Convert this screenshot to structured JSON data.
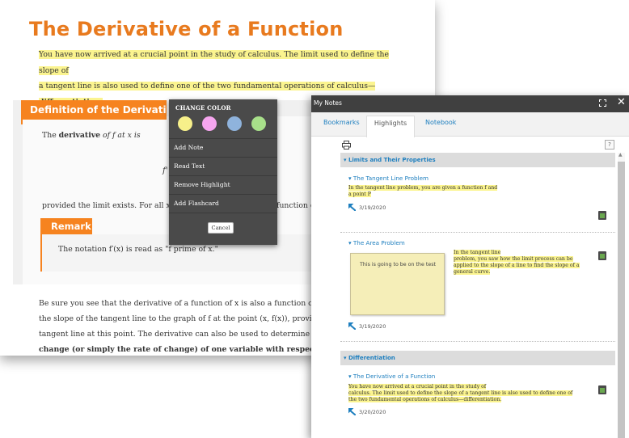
{
  "book": {
    "title": "The Derivative of a Function",
    "intro_line1": "You have now arrived at a crucial point in the study of calculus. The limit used to define the slope of",
    "intro_line2": "a tangent line is also used to define one of the two fundamental operations of calculus—",
    "intro_line3": "differentiation.",
    "definition_tab": "Definition of the Derivative",
    "definition_text_prefix": "The ",
    "definition_text_bold": "derivative",
    "definition_text_suffix": " of f at x is",
    "formula_fragment": "f'",
    "provided_text": "provided the limit exists. For all x fo",
    "provided_tail": "function o",
    "remark_tab": "Remark",
    "remark_text": "The notation f′(x) is read as \"f prime of x.\"",
    "body_line1": "Be sure you see that the derivative of a function of x is also a function of x. Th",
    "body_line2": "the slope of the tangent line to the graph of f at the point (x, f(x)), provided t",
    "body_line3": "tangent line at this point. The derivative can also be used to determine the ins",
    "body_line4": "change (or simply the rate of change) of one variable with respect to anothe"
  },
  "context_menu": {
    "title": "CHANGE COLOR",
    "colors": [
      "#f7f08a",
      "#f6a6ef",
      "#8fb3dc",
      "#a8e08a"
    ],
    "items": [
      "Add Note",
      "Read Text",
      "Remove Highlight",
      "Add Flashcard"
    ],
    "cancel": "Cancel"
  },
  "notes_panel": {
    "title": "My Notes",
    "tabs": [
      "Bookmarks",
      "Highlights",
      "Notebook"
    ],
    "active_tab": "Highlights",
    "help": "?",
    "sections": [
      {
        "heading": "▾ Limits and Their Properties",
        "notes": [
          {
            "link": "▾ The Tangent Line Problem",
            "quote_line1": "In the tangent line problem, you are given a function f and",
            "quote_line2": "a point P",
            "date": "3/19/2020"
          },
          {
            "link": "▾ The Area Problem",
            "sticky_text": "This is going to be on the test",
            "quote_line1": "In the tangent line",
            "quote_line2": "problem, you saw how the limit process can be",
            "quote_line3": "applied to the slope of a line to find the slope of a",
            "quote_line4": "general curve.",
            "date": "3/19/2020"
          }
        ]
      },
      {
        "heading": "▾ Differentiation",
        "notes": [
          {
            "link": "▾ The Derivative of a Function",
            "quote_line1": "You have now arrived at a crucial point in the study of",
            "quote_line2": "calculus. The limit used to define the slope of a tangent line is also used to define one of",
            "quote_line3": "the two fundamental operations of calculus—differentiation.",
            "date": "3/20/2020"
          }
        ]
      }
    ]
  },
  "colors": {
    "accent_orange": "#f6831f",
    "title_orange": "#e87a1e",
    "link_blue": "#1e7fbf",
    "highlight_yellow": "#fbf48f"
  }
}
